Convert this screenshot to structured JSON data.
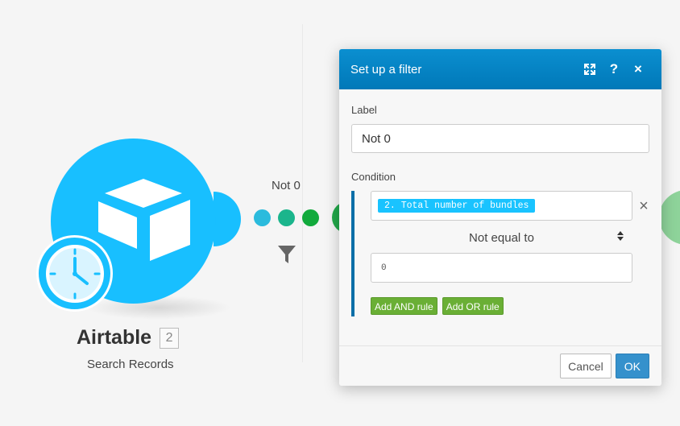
{
  "module": {
    "title": "Airtable",
    "id": "2",
    "subtitle": "Search Records",
    "icons": [
      "airtable-cube-icon",
      "clock-icon"
    ],
    "color": "#18bfff"
  },
  "link": {
    "label": "Not 0",
    "filter_icon": "funnel-icon"
  },
  "dialog": {
    "title": "Set up a filter",
    "header_buttons": [
      "expand-icon",
      "help-icon",
      "close-icon"
    ],
    "help_glyph": "?",
    "close_glyph": "×",
    "label_field": {
      "label": "Label",
      "value": "Not 0"
    },
    "condition": {
      "label": "Condition",
      "operand": "2. Total number of bundles",
      "operator": "Not equal to",
      "value": "0",
      "remove_glyph": "×"
    },
    "add_and_label": "Add AND rule",
    "add_or_label": "Add OR rule",
    "cancel_label": "Cancel",
    "ok_label": "OK",
    "header_color": "#0b8fd0"
  }
}
